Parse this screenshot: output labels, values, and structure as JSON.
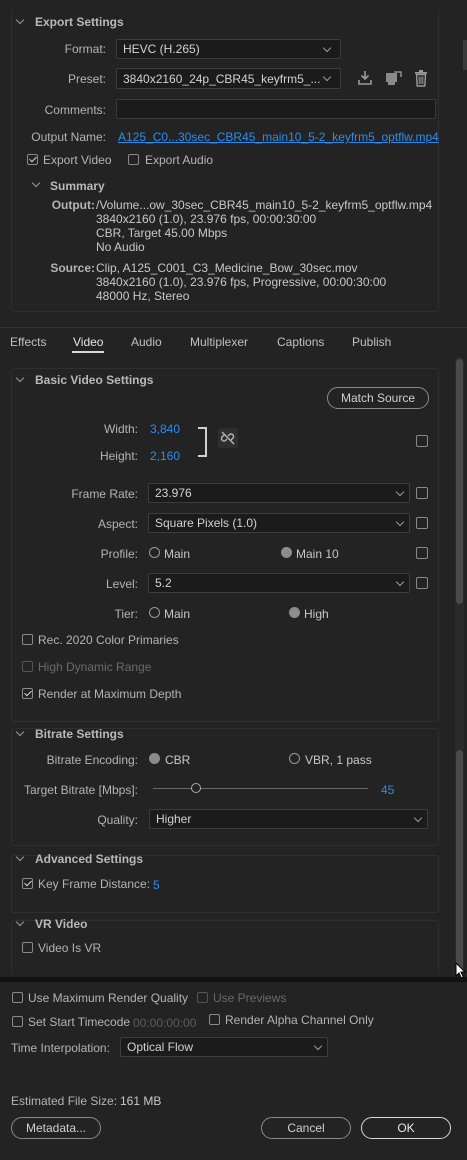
{
  "export_settings": {
    "header": "Export Settings",
    "format_label": "Format:",
    "format_value": "HEVC (H.265)",
    "preset_label": "Preset:",
    "preset_value": "3840x2160_24p_CBR45_keyfrm5_...",
    "comments_label": "Comments:",
    "comments_value": "",
    "output_name_label": "Output Name:",
    "output_name_value": "A125_C0...30sec_CBR45_main10_5-2_keyfrm5_optflw.mp4",
    "export_video_label": "Export Video",
    "export_video_checked": true,
    "export_audio_label": "Export Audio",
    "export_audio_checked": false
  },
  "summary": {
    "header": "Summary",
    "output_label": "Output:",
    "output_lines": [
      "/Volume...ow_30sec_CBR45_main10_5-2_keyfrm5_optflw.mp4",
      "3840x2160 (1.0), 23.976 fps, 00:00:30:00",
      "CBR, Target 45.00 Mbps",
      "No Audio"
    ],
    "source_label": "Source:",
    "source_lines": [
      "Clip, A125_C001_C3_Medicine_Bow_30sec.mov",
      "3840x2160 (1.0), 23.976 fps, Progressive, 00:00:30:00",
      "48000 Hz, Stereo"
    ]
  },
  "tabs": [
    "Effects",
    "Video",
    "Audio",
    "Multiplexer",
    "Captions",
    "Publish"
  ],
  "active_tab": "Video",
  "basic_video": {
    "header": "Basic Video Settings",
    "match_source": "Match Source",
    "width_label": "Width:",
    "width_value": "3,840",
    "height_label": "Height:",
    "height_value": "2,160",
    "frame_rate_label": "Frame Rate:",
    "frame_rate_value": "23.976",
    "aspect_label": "Aspect:",
    "aspect_value": "Square Pixels (1.0)",
    "profile_label": "Profile:",
    "profile_options": [
      "Main",
      "Main 10"
    ],
    "profile_selected": "Main 10",
    "level_label": "Level:",
    "level_value": "5.2",
    "tier_label": "Tier:",
    "tier_options": [
      "Main",
      "High"
    ],
    "tier_selected": "High",
    "rec2020_label": "Rec. 2020 Color Primaries",
    "rec2020_checked": false,
    "hdr_label": "High Dynamic Range",
    "hdr_checked": false,
    "max_depth_label": "Render at Maximum Depth",
    "max_depth_checked": true
  },
  "bitrate": {
    "header": "Bitrate Settings",
    "encoding_label": "Bitrate Encoding:",
    "encoding_options": [
      "CBR",
      "VBR, 1 pass"
    ],
    "encoding_selected": "CBR",
    "target_label": "Target Bitrate [Mbps]:",
    "target_value": "45",
    "target_fraction": 0.2,
    "quality_label": "Quality:",
    "quality_value": "Higher"
  },
  "advanced": {
    "header": "Advanced Settings",
    "keyframe_label": "Key Frame Distance:",
    "keyframe_checked": true,
    "keyframe_value": "5"
  },
  "vr": {
    "header": "VR Video",
    "vr_label": "Video Is VR",
    "vr_checked": false
  },
  "bottom": {
    "max_render_label": "Use Maximum Render Quality",
    "max_render_checked": false,
    "previews_label": "Use Previews",
    "previews_checked": false,
    "start_tc_label": "Set Start Timecode",
    "start_tc_checked": false,
    "start_tc_value": "00:00:00:00",
    "alpha_label": "Render Alpha Channel Only",
    "alpha_checked": false,
    "interp_label": "Time Interpolation:",
    "interp_value": "Optical Flow",
    "file_size_label": "Estimated File Size:",
    "file_size_value": "161 MB",
    "metadata_button": "Metadata...",
    "cancel_button": "Cancel",
    "ok_button": "OK"
  },
  "colors": {
    "accent_blue": "#2d8ceb",
    "background": "#232323"
  }
}
